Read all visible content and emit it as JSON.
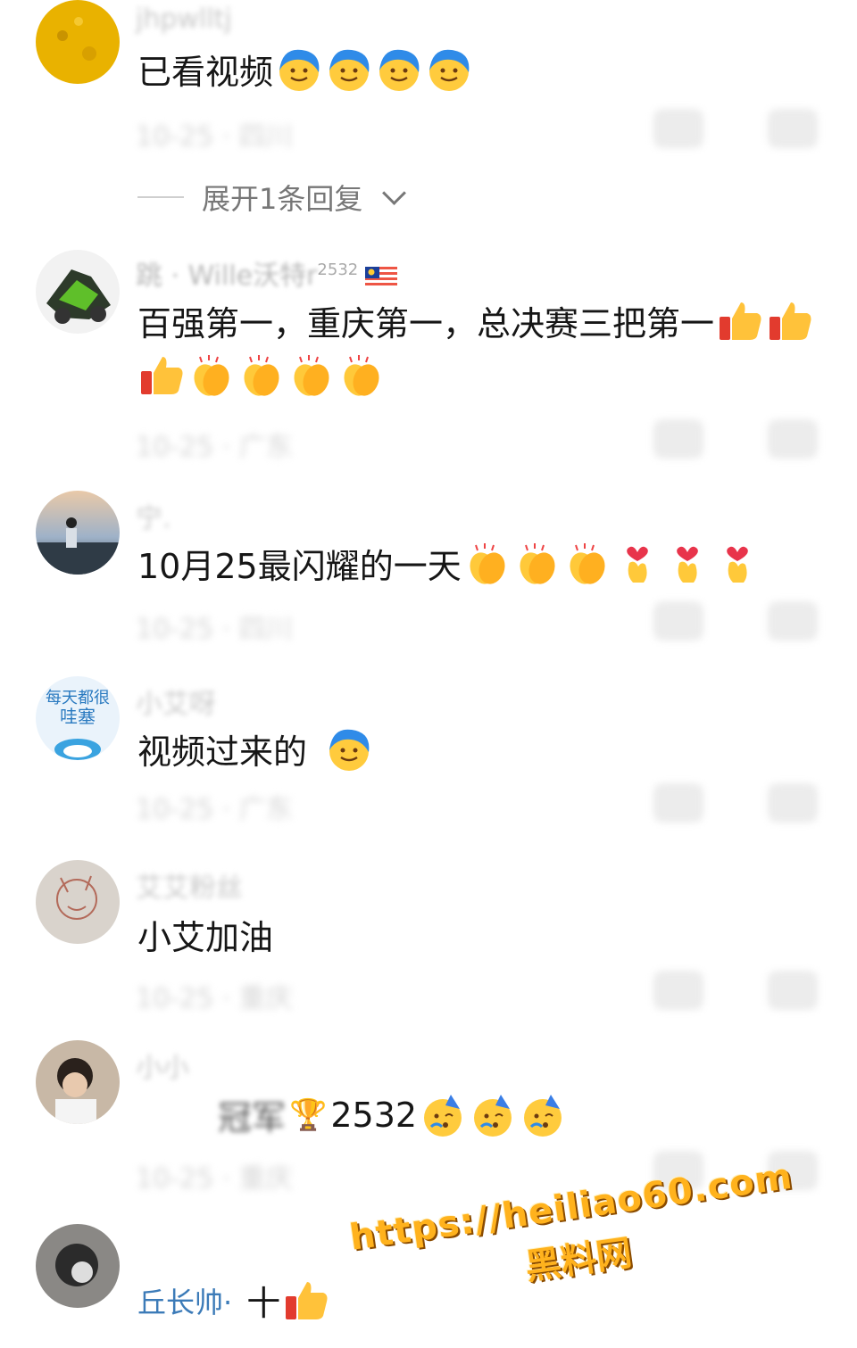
{
  "comments": [
    {
      "username": "jhpwlltj",
      "text": "已看视频",
      "emoji": [
        "shy",
        "shy",
        "shy",
        "shy"
      ],
      "meta": "10-25 · 四川",
      "expand": "展开1条回复"
    },
    {
      "username": "跳 · Wille沃特r",
      "badge": "2532",
      "text_line1": "百强第一，重庆第一，总决赛三把第一",
      "emoji_line1": [
        "thumbs",
        "thumbs"
      ],
      "emoji_line2": [
        "thumbs",
        "clap",
        "clap",
        "clap",
        "clap"
      ],
      "meta": "10-25 · 广东"
    },
    {
      "username": "宁.",
      "text": "10月25最闪耀的一天",
      "emoji": [
        "clap",
        "clap",
        "clap",
        "heart",
        "heart",
        "heart"
      ],
      "meta": "10-25 · 四川"
    },
    {
      "username": "小艾呀",
      "text": "视频过来的",
      "emoji": [
        "shy"
      ],
      "meta": "10-25 · 广东"
    },
    {
      "username": "艾艾粉丝",
      "text": "小艾加油",
      "emoji": [],
      "meta": "10-25 · 重庆"
    },
    {
      "username": "小小",
      "text_prefix": "冠军",
      "trophy": "🏆",
      "text": "2532",
      "emoji": [
        "party",
        "party",
        "party"
      ],
      "meta": "10-25 · 重庆"
    },
    {
      "username": "丘长帅·",
      "text": "十",
      "emoji": [
        "thumbs"
      ],
      "meta": ""
    }
  ],
  "watermark": {
    "url": "https://heiliao60.com",
    "cn": "黑料网"
  }
}
